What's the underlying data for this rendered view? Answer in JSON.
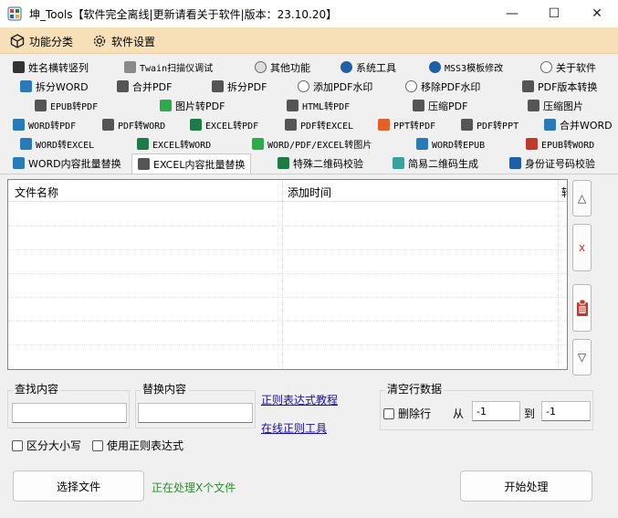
{
  "window": {
    "title": "坤_Tools【软件完全离线|更新请看关于软件|版本：23.10.20】",
    "min": "—",
    "max": "☐",
    "close": "✕"
  },
  "menu": [
    {
      "label": "功能分类",
      "icon": "cube-icon"
    },
    {
      "label": "软件设置",
      "icon": "gear-icon"
    }
  ],
  "tabs": {
    "row1": [
      "姓名横转竖列",
      "Twain扫描仪调试",
      "其他功能",
      "系统工具",
      "MSS3模板修改",
      "关于软件"
    ],
    "row2": [
      "拆分WORD",
      "合并PDF",
      "拆分PDF",
      "添加PDF水印",
      "移除PDF水印",
      "PDF版本转换"
    ],
    "row3": [
      "EPUB转PDF",
      "图片转PDF",
      "HTML转PDF",
      "压缩PDF",
      "压缩图片"
    ],
    "row4": [
      "WORD转PDF",
      "PDF转WORD",
      "EXCEL转PDF",
      "PDF转EXCEL",
      "PPT转PDF",
      "PDF转PPT",
      "合并WORD"
    ],
    "row5": [
      "WORD转EXCEL",
      "EXCEL转WORD",
      "WORD/PDF/EXCEL转图片",
      "WORD转EPUB",
      "EPUB转WORD"
    ],
    "row6": [
      "WORD内容批量替换",
      "EXCEL内容批量替换",
      "特殊二维码校验",
      "简易二维码生成",
      "身份证号码校验"
    ],
    "active": "EXCEL内容批量替换"
  },
  "file_list": {
    "columns": [
      "文件名称",
      "添加时间",
      "转"
    ],
    "rows": []
  },
  "side_buttons": {
    "up": "△",
    "remove": "x",
    "clear": "clipboard-icon",
    "down": "▽"
  },
  "find": {
    "label": "查找内容",
    "value": ""
  },
  "replace": {
    "label": "替换内容",
    "value": ""
  },
  "links": {
    "regex_tutorial": "正则表达式教程",
    "regex_tool": "在线正则工具"
  },
  "clear_blank": {
    "label": "清空行数据",
    "delete_rows": "删除行",
    "from_label": "从",
    "from_value": "-1",
    "to_label": "到",
    "to_value": "-1"
  },
  "options": {
    "case_sensitive": "区分大小写",
    "use_regex": "使用正则表达式"
  },
  "buttons": {
    "select_file": "选择文件",
    "start": "开始处理"
  },
  "status": "正在处理X个文件"
}
